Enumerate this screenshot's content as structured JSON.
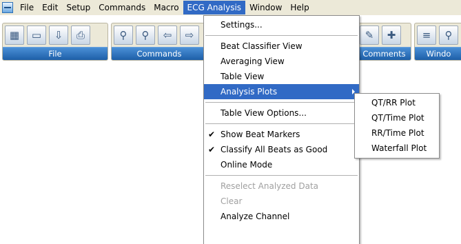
{
  "menubar": {
    "items": [
      "File",
      "Edit",
      "Setup",
      "Commands",
      "Macro",
      "ECG Analysis",
      "Window",
      "Help"
    ]
  },
  "toolbars": {
    "file_label": "File",
    "commands_label": "Commands",
    "comments_label": "Comments",
    "window_label": "Windo"
  },
  "ecg_menu": {
    "settings": "Settings...",
    "beat_classifier": "Beat Classifier View",
    "averaging": "Averaging View",
    "table_view": "Table View",
    "analysis_plots": "Analysis Plots",
    "table_view_options": "Table View Options...",
    "show_beat_markers": "Show Beat Markers",
    "classify_all": "Classify All Beats as Good",
    "online_mode": "Online Mode",
    "reselect": "Reselect Analyzed Data",
    "clear": "Clear",
    "analyze_channel": "Analyze Channel"
  },
  "submenu": {
    "items": [
      "QT/RR Plot",
      "QT/Time Plot",
      "RR/Time Plot",
      "Waterfall Plot"
    ]
  },
  "colors": {
    "menu_highlight": "#316ac5",
    "toolbar_caption": "#1d5fa8",
    "menubar_bg": "#ece9d8"
  }
}
